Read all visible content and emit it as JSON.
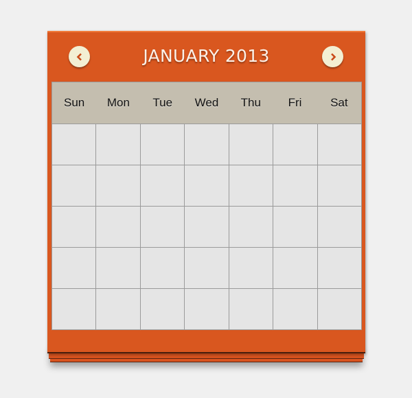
{
  "calendar": {
    "title": "JANUARY 2013",
    "prev_icon": "chevron-left-icon",
    "next_icon": "chevron-right-icon",
    "weekdays": [
      "Sun",
      "Mon",
      "Tue",
      "Wed",
      "Thu",
      "Fri",
      "Sat"
    ],
    "weeks": 5,
    "colors": {
      "accent": "#d9571f",
      "header_bg": "#c4beaf",
      "cell_bg": "#e5e5e5",
      "button_bg": "#f3efd3"
    }
  }
}
